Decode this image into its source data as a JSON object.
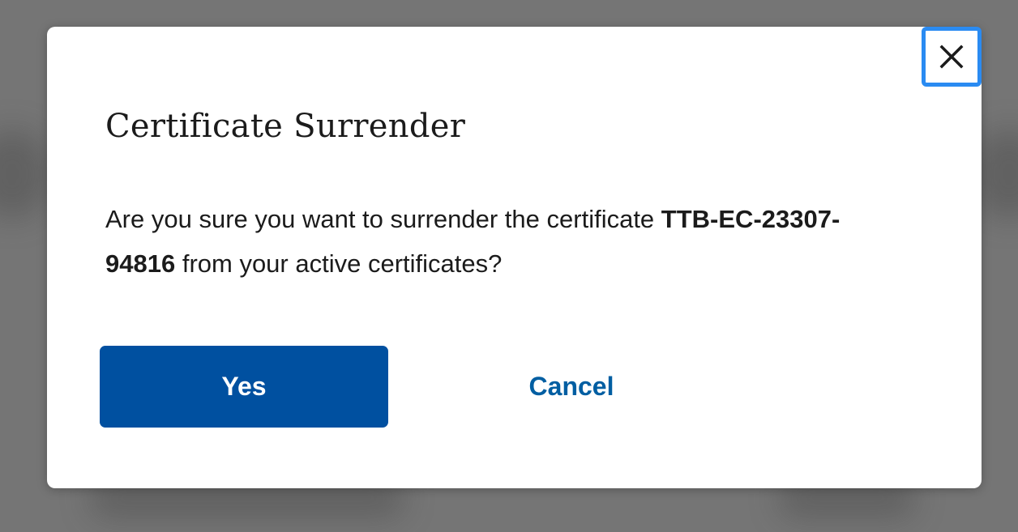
{
  "modal": {
    "title": "Certificate Surrender",
    "message": {
      "prefix": "Are you sure you want to surrender the certificate ",
      "certificate_id": "TTB-EC-23307-94816",
      "suffix": " from your active certificates?"
    },
    "buttons": {
      "confirm_label": "Yes",
      "cancel_label": "Cancel"
    },
    "close_icon": "close-icon"
  },
  "colors": {
    "overlay": "#757575",
    "primary_button": "#0050a0",
    "link": "#005ea2",
    "focus_outline": "#2a8bf2"
  }
}
